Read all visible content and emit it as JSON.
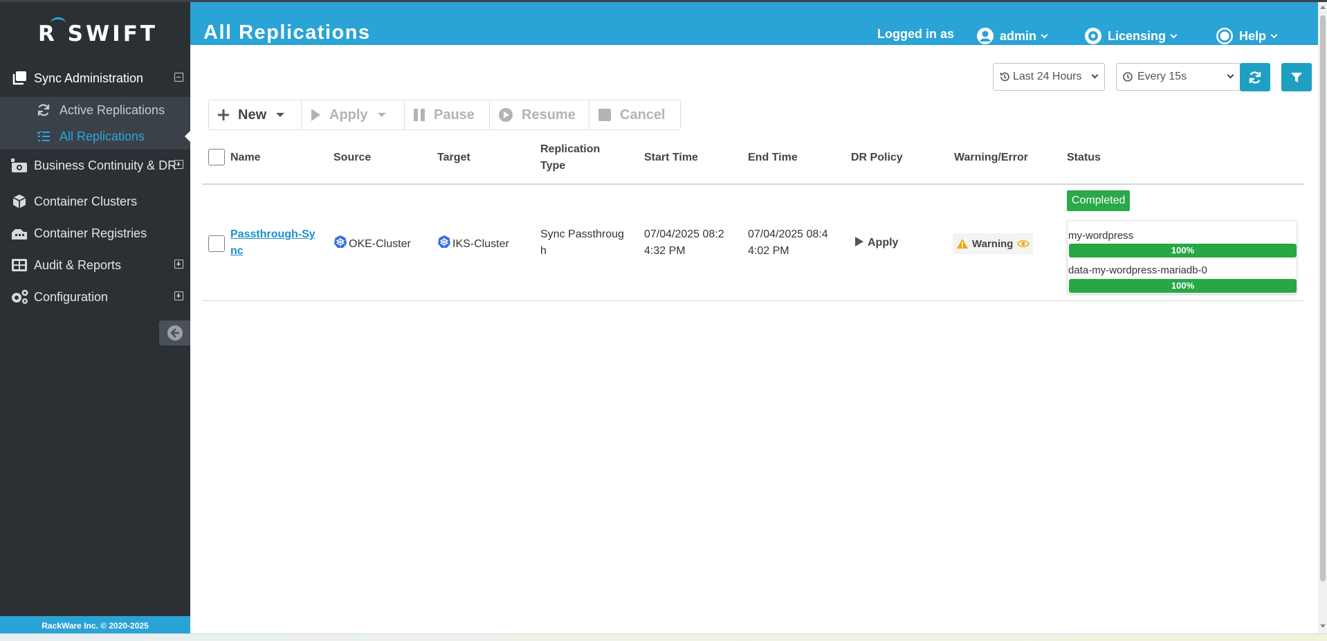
{
  "app": {
    "logo": "R SWIFT",
    "footer": "RackWare Inc. © 2020-2025"
  },
  "sidebar": {
    "items": [
      {
        "label": "Sync Administration",
        "icon": "copy-icon",
        "toggle": "minus"
      },
      {
        "label": "Business Continuity & DR",
        "icon": "dr-icon",
        "toggle": "plus"
      },
      {
        "label": "Container Clusters",
        "icon": "cube-icon"
      },
      {
        "label": "Container Registries",
        "icon": "registry-icon"
      },
      {
        "label": "Audit & Reports",
        "icon": "grid-icon",
        "toggle": "plus"
      },
      {
        "label": "Configuration",
        "icon": "gears-icon",
        "toggle": "plus"
      }
    ],
    "subitems": [
      {
        "label": "Active Replications",
        "icon": "refresh-icon"
      },
      {
        "label": "All Replications",
        "icon": "list-icon",
        "active": true
      }
    ]
  },
  "header": {
    "title": "All Replications",
    "logged_in_label": "Logged in as",
    "user": "admin",
    "licensing": "Licensing",
    "help": "Help"
  },
  "filters": {
    "time_range": "Last 24 Hours",
    "refresh_interval": "Every 15s"
  },
  "toolbar": {
    "new": "New",
    "apply": "Apply",
    "pause": "Pause",
    "resume": "Resume",
    "cancel": "Cancel"
  },
  "table": {
    "headers": {
      "name": "Name",
      "source": "Source",
      "target": "Target",
      "replication_type_1": "Replication",
      "replication_type_2": "Type",
      "start_time": "Start Time",
      "end_time": "End Time",
      "dr_policy": "DR Policy",
      "warning_error": "Warning/Error",
      "status": "Status"
    },
    "rows": [
      {
        "name_1": "Passthrough-Sy",
        "name_2": "nc",
        "source": "OKE-Cluster",
        "target": "IKS-Cluster",
        "type_1": "Sync Passthroug",
        "type_2": "h",
        "start_1": "07/04/2025 08:2",
        "start_2": "4:32 PM",
        "end_1": "07/04/2025 08:4",
        "end_2": "4:02 PM",
        "dr_policy": "Apply",
        "warning": "Warning",
        "status": "Completed",
        "volumes": [
          {
            "name": "my-wordpress",
            "progress": "100%"
          },
          {
            "name": "data-my-wordpress-mariadb-0",
            "progress": "100%"
          }
        ]
      }
    ]
  },
  "colors": {
    "accent": "#2aa3d6",
    "sidebar": "#2b3035",
    "success": "#28a745",
    "warning": "#f0a800"
  }
}
